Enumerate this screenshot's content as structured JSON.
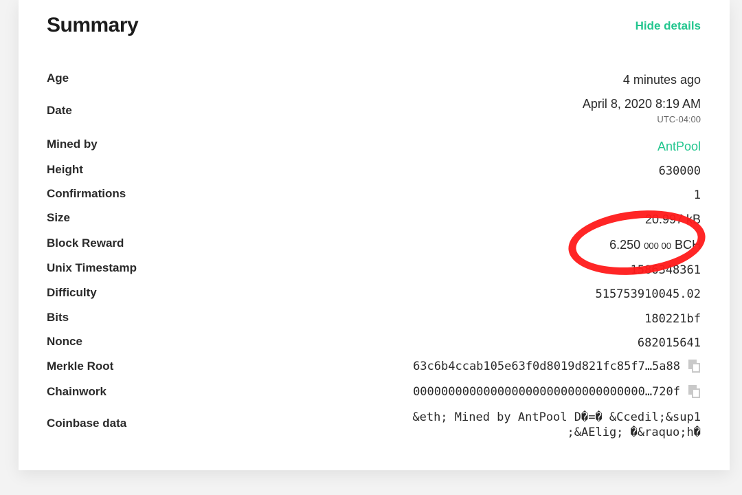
{
  "summary": {
    "title": "Summary",
    "hide_details_label": "Hide details",
    "rows": {
      "age": {
        "label": "Age",
        "value": "4 minutes ago"
      },
      "date": {
        "label": "Date",
        "value": "April 8, 2020 8:19 AM",
        "timezone": "UTC-04:00"
      },
      "mined_by": {
        "label": "Mined by",
        "value": "AntPool"
      },
      "height": {
        "label": "Height",
        "value": "630000"
      },
      "confirmations": {
        "label": "Confirmations",
        "value": "1"
      },
      "size": {
        "label": "Size",
        "value": "20.997 kB"
      },
      "block_reward": {
        "label": "Block Reward",
        "value_main": "6.250",
        "value_small": "000 00",
        "unit": "BCH"
      },
      "unix_timestamp": {
        "label": "Unix Timestamp",
        "value": "1586348361"
      },
      "difficulty": {
        "label": "Difficulty",
        "value": "515753910045.02"
      },
      "bits": {
        "label": "Bits",
        "value": "180221bf"
      },
      "nonce": {
        "label": "Nonce",
        "value": "682015641"
      },
      "merkle_root": {
        "label": "Merkle Root",
        "value": "63c6b4ccab105e63f0d8019d821fc85f7…5a88"
      },
      "chainwork": {
        "label": "Chainwork",
        "value": "000000000000000000000000000000000…720f"
      },
      "coinbase_data": {
        "label": "Coinbase data",
        "line1": "&eth; Mined by AntPool D�=� &Ccedil;&sup1",
        "line2": ";&AElig; �&raquo;h�"
      }
    }
  },
  "colors": {
    "accent": "#23c68f",
    "annotation": "#ff1a1a"
  },
  "icons": {
    "copy": "copy-icon"
  }
}
